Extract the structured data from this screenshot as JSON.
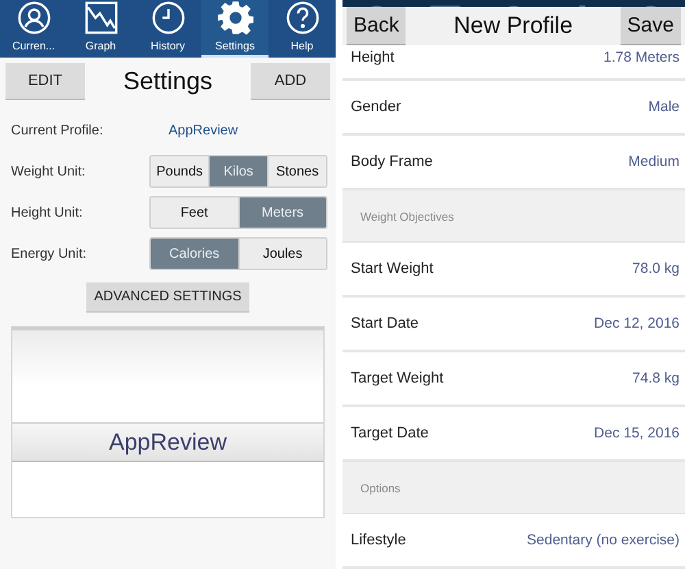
{
  "left_screen": {
    "tabs": [
      {
        "label": "Curren...",
        "kind": "profile",
        "selected": false
      },
      {
        "label": "Graph",
        "kind": "graph",
        "selected": false
      },
      {
        "label": "History",
        "kind": "history",
        "selected": false
      },
      {
        "label": "Settings",
        "kind": "settings",
        "selected": true
      },
      {
        "label": "Help",
        "kind": "help",
        "selected": false
      }
    ],
    "header": {
      "left_button": "EDIT",
      "title": "Settings",
      "right_button": "ADD"
    },
    "current_profile": {
      "label": "Current Profile:",
      "value": "AppReview"
    },
    "unit_settings": [
      {
        "label": "Weight Unit:",
        "options": [
          {
            "label": "Pounds",
            "selected": false
          },
          {
            "label": "Kilos",
            "selected": true
          },
          {
            "label": "Stones",
            "selected": false
          }
        ]
      },
      {
        "label": "Height Unit:",
        "options": [
          {
            "label": "Feet",
            "selected": false
          },
          {
            "label": "Meters",
            "selected": true
          }
        ]
      },
      {
        "label": "Energy Unit:",
        "options": [
          {
            "label": "Calories",
            "selected": true
          },
          {
            "label": "Joules",
            "selected": false
          }
        ]
      }
    ],
    "advanced_button": "ADVANCED SETTINGS",
    "profile_list": [
      {
        "name": "AppReview",
        "selected": true
      }
    ]
  },
  "right_screen": {
    "header": {
      "back_button": "Back",
      "title": "New Profile",
      "save_button": "Save"
    },
    "rows": [
      {
        "kind": "field",
        "label": "Height",
        "value": "1.78 Meters"
      },
      {
        "kind": "field",
        "label": "Gender",
        "value": "Male"
      },
      {
        "kind": "field",
        "label": "Body Frame",
        "value": "Medium"
      },
      {
        "kind": "section",
        "label": "Weight Objectives"
      },
      {
        "kind": "field",
        "label": "Start Weight",
        "value": "78.0 kg"
      },
      {
        "kind": "field",
        "label": "Start Date",
        "value": "Dec 12, 2016"
      },
      {
        "kind": "field",
        "label": "Target Weight",
        "value": "74.8 kg"
      },
      {
        "kind": "field",
        "label": "Target Date",
        "value": "Dec 15, 2016"
      },
      {
        "kind": "section",
        "label": "Options"
      },
      {
        "kind": "field",
        "label": "Lifestyle",
        "value": "Sedentary (no exercise)"
      }
    ]
  }
}
